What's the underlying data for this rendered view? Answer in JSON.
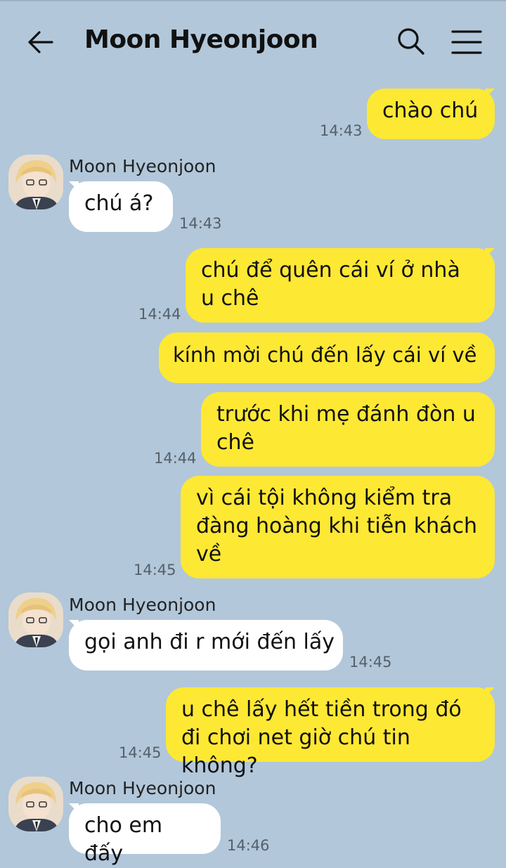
{
  "header": {
    "title": "Moon Hyeonjoon",
    "back_icon": "arrow-left-icon",
    "search_icon": "search-icon",
    "menu_icon": "hamburger-menu-icon"
  },
  "colors": {
    "background": "#b2c7da",
    "outgoing_bubble": "#fde834",
    "incoming_bubble": "#ffffff"
  },
  "messages": [
    {
      "direction": "out",
      "text": "chào chú",
      "time": "14:43"
    },
    {
      "direction": "in",
      "sender": "Moon Hyeonjoon",
      "text": "chú á?",
      "time": "14:43"
    },
    {
      "direction": "out",
      "text": "chú để quên cái ví ở nhà u chê",
      "time": "14:44"
    },
    {
      "direction": "out",
      "text": "kính mời chú đến lấy cái ví về",
      "time": ""
    },
    {
      "direction": "out",
      "text": "trước khi mẹ đánh đòn u chê",
      "time": "14:44"
    },
    {
      "direction": "out",
      "text": "vì cái tội không kiểm tra đàng hoàng khi tiễn khách về",
      "time": "14:45"
    },
    {
      "direction": "in",
      "sender": "Moon Hyeonjoon",
      "text": "gọi anh đi r mới đến lấy",
      "time": "14:45"
    },
    {
      "direction": "out",
      "text": "u chê lấy hết tiền trong đó đi chơi net giờ chú tin không?",
      "time": "14:45"
    },
    {
      "direction": "in",
      "sender": "Moon Hyeonjoon",
      "text": "cho em đấy",
      "time": "14:46"
    }
  ]
}
